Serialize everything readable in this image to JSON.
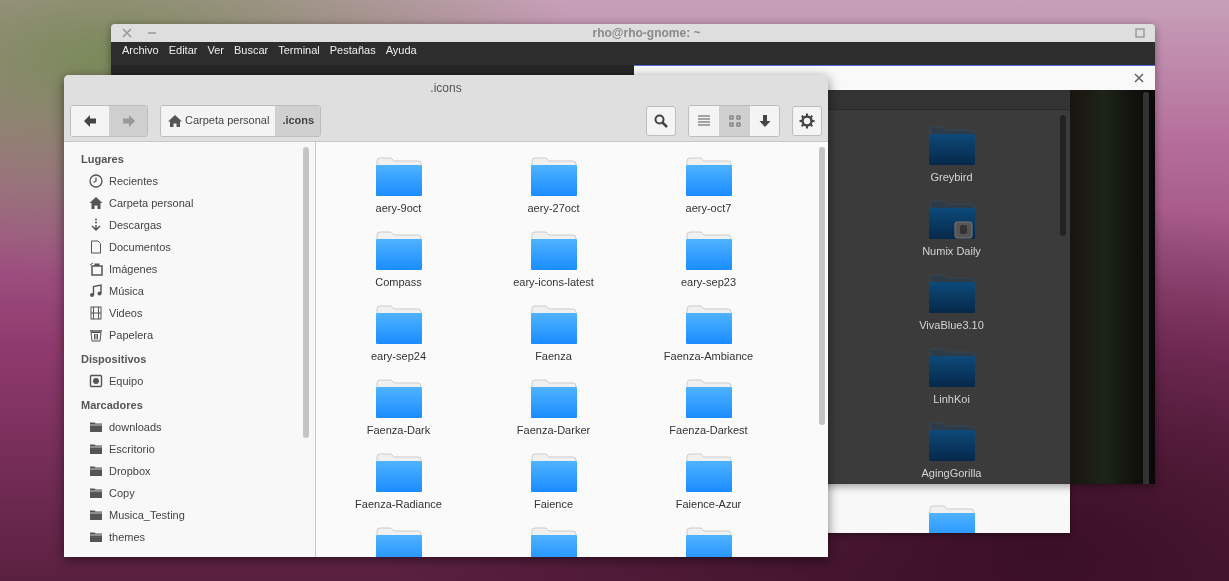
{
  "terminal_window": {
    "title": "rho@rho-gnome: ~",
    "menu": [
      "Archivo",
      "Editar",
      "Ver",
      "Buscar",
      "Terminal",
      "Pestañas",
      "Ayuda"
    ]
  },
  "background_file_window": {
    "folders": [
      {
        "name": "Greybird",
        "locked": false
      },
      {
        "name": "Numix Daily",
        "locked": true
      },
      {
        "name": "VivaBlue3.10",
        "locked": false
      },
      {
        "name": "LinhKoi",
        "locked": false
      },
      {
        "name": "AgingGorilla",
        "locked": false
      }
    ],
    "next_folder": {
      "locked": false
    }
  },
  "file_window": {
    "title": ".icons",
    "nav": [
      {
        "kind": "back",
        "disabled": false
      },
      {
        "kind": "forward",
        "disabled": true
      }
    ],
    "path": [
      {
        "label": "Carpeta personal",
        "kind": "home",
        "selected": false
      },
      {
        "label": ".icons",
        "kind": "plain",
        "selected": true
      }
    ],
    "view_buttons": [
      {
        "kind": "list",
        "selected": false
      },
      {
        "kind": "grid",
        "selected": true
      },
      {
        "kind": "sort",
        "selected": false
      }
    ],
    "sidebar": [
      {
        "heading": "Lugares",
        "items": [
          {
            "label": "Recientes",
            "kind": "recent"
          },
          {
            "label": "Carpeta personal",
            "kind": "home"
          },
          {
            "label": "Descargas",
            "kind": "downloads"
          },
          {
            "label": "Documentos",
            "kind": "document"
          },
          {
            "label": "Imágenes",
            "kind": "pictures"
          },
          {
            "label": "Música",
            "kind": "music"
          },
          {
            "label": "Videos",
            "kind": "video"
          },
          {
            "label": "Papelera",
            "kind": "trash"
          }
        ]
      },
      {
        "heading": "Dispositivos",
        "items": [
          {
            "label": "Equipo",
            "kind": "disk"
          }
        ]
      },
      {
        "heading": "Marcadores",
        "items": [
          {
            "label": "downloads",
            "kind": "folder"
          },
          {
            "label": "Escritorio",
            "kind": "folder"
          },
          {
            "label": "Dropbox",
            "kind": "folder"
          },
          {
            "label": "Copy",
            "kind": "folder"
          },
          {
            "label": "Musica_Testing",
            "kind": "folder"
          },
          {
            "label": "themes",
            "kind": "folder"
          }
        ]
      }
    ],
    "folders": [
      {
        "kind": "named",
        "name": "aery-9oct"
      },
      {
        "kind": "named",
        "name": "aery-27oct"
      },
      {
        "kind": "named",
        "name": "aery-oct7"
      },
      {
        "kind": "named",
        "name": "Compass"
      },
      {
        "kind": "named",
        "name": "eary-icons-latest"
      },
      {
        "kind": "named",
        "name": "eary-sep23"
      },
      {
        "kind": "named",
        "name": "eary-sep24"
      },
      {
        "kind": "named",
        "name": "Faenza"
      },
      {
        "kind": "named",
        "name": "Faenza-Ambiance"
      },
      {
        "kind": "named",
        "name": "Faenza-Dark"
      },
      {
        "kind": "named",
        "name": "Faenza-Darker"
      },
      {
        "kind": "named",
        "name": "Faenza-Darkest"
      },
      {
        "kind": "named",
        "name": "Faenza-Radiance"
      },
      {
        "kind": "named",
        "name": "Faience"
      },
      {
        "kind": "named",
        "name": "Faience-Azur"
      },
      {
        "kind": "cut"
      },
      {
        "kind": "cut"
      },
      {
        "kind": "cut"
      }
    ]
  }
}
